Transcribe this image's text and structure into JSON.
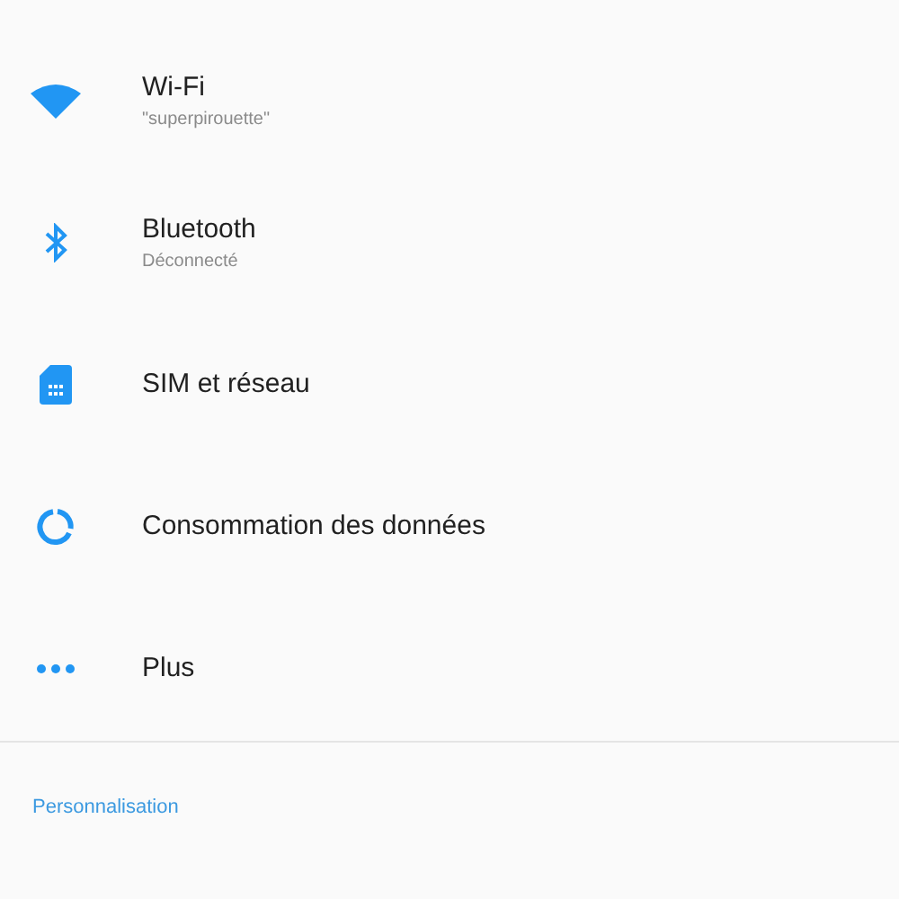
{
  "settings": [
    {
      "kind": "wifi",
      "title": "Wi-Fi",
      "subtitle": "\"superpirouette\""
    },
    {
      "kind": "bluetooth",
      "title": "Bluetooth",
      "subtitle": "Déconnecté"
    },
    {
      "kind": "sim",
      "title": "SIM et réseau"
    },
    {
      "kind": "data",
      "title": "Consommation des données"
    },
    {
      "kind": "more",
      "title": "Plus"
    }
  ],
  "section_header": "Personnalisation"
}
